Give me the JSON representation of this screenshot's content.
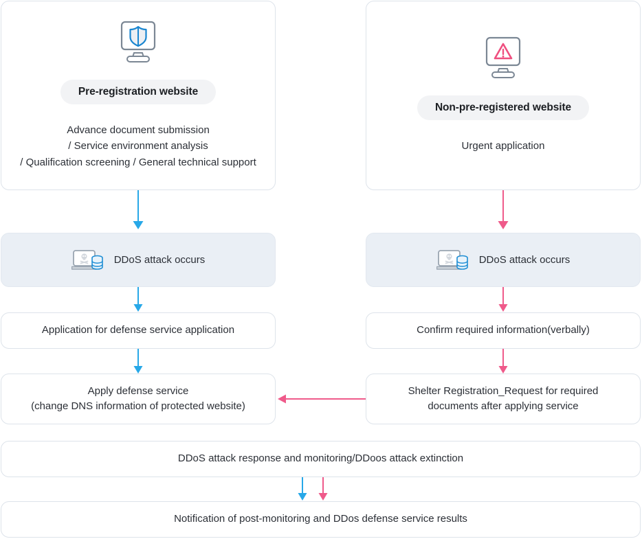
{
  "colors": {
    "blue": "#27a8e8",
    "pink": "#ef5a8a",
    "pink_strong": "#e84d80",
    "border": "#dde3ea",
    "fill_panel": "#eaeff5",
    "pill_bg": "#f2f3f5",
    "text": "#2b2f36",
    "icon_gray": "#7b8794"
  },
  "columns": {
    "left": {
      "card": {
        "icon": "monitor-shield-icon",
        "badge": "Pre-registration website",
        "description": "Advance document submission\n/ Service environment analysis\n/ Qualification screening / General technical support"
      },
      "attack_box": {
        "icon": "laptop-skull-database-icon",
        "label": "DDoS attack occurs"
      },
      "step_1": "Application for defense service application",
      "step_2": "Apply defense service\n(change DNS information of protected website)"
    },
    "right": {
      "card": {
        "icon": "monitor-warning-icon",
        "badge": "Non-pre-registered website",
        "description": "Urgent application"
      },
      "attack_box": {
        "icon": "laptop-skull-database-icon",
        "label": "DDoS attack occurs"
      },
      "step_1": "Confirm required information(verbally)",
      "step_2": "Shelter Registration_Request for required\ndocuments after applying service"
    }
  },
  "shared": {
    "response_box": "DDoS attack response and monitoring/DDoos attack extinction",
    "result_box": "Notification of post-monitoring and DDos defense service results"
  }
}
